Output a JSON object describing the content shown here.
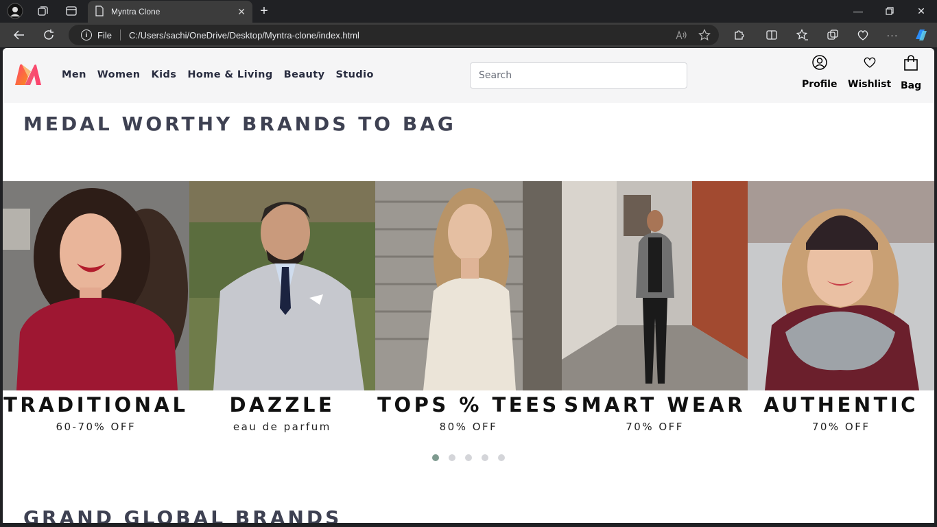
{
  "browser": {
    "tab_title": "Myntra Clone",
    "address_label": "File",
    "url": "C:/Users/sachi/OneDrive/Desktop/Myntra-clone/index.html"
  },
  "header": {
    "nav": [
      "Men",
      "Women",
      "Kids",
      "Home & Living",
      "Beauty",
      "Studio"
    ],
    "search_placeholder": "Search",
    "actions": {
      "profile": "Profile",
      "wishlist": "Wishlist",
      "bag": "Bag"
    }
  },
  "sections": {
    "medal_title": "MEDAL WORTHY BRANDS TO BAG",
    "grand_title": "GRAND GLOBAL BRANDS"
  },
  "banners": [
    {
      "title": "TRADITIONAL",
      "subtitle": "60-70% OFF"
    },
    {
      "title": "DAZZLE",
      "subtitle": "eau de parfum"
    },
    {
      "title": "TOPS % TEES",
      "subtitle": "80% OFF"
    },
    {
      "title": "SMART WEAR",
      "subtitle": "70% OFF"
    },
    {
      "title": "AUTHENTIC",
      "subtitle": "70% OFF"
    }
  ],
  "carousel": {
    "total": 5,
    "active": 1
  },
  "colors": {
    "logo_pink": "#ff3f6c",
    "logo_orange": "#f98f1c",
    "title": "#3e4152",
    "active_dot": "#7e9a8f"
  }
}
